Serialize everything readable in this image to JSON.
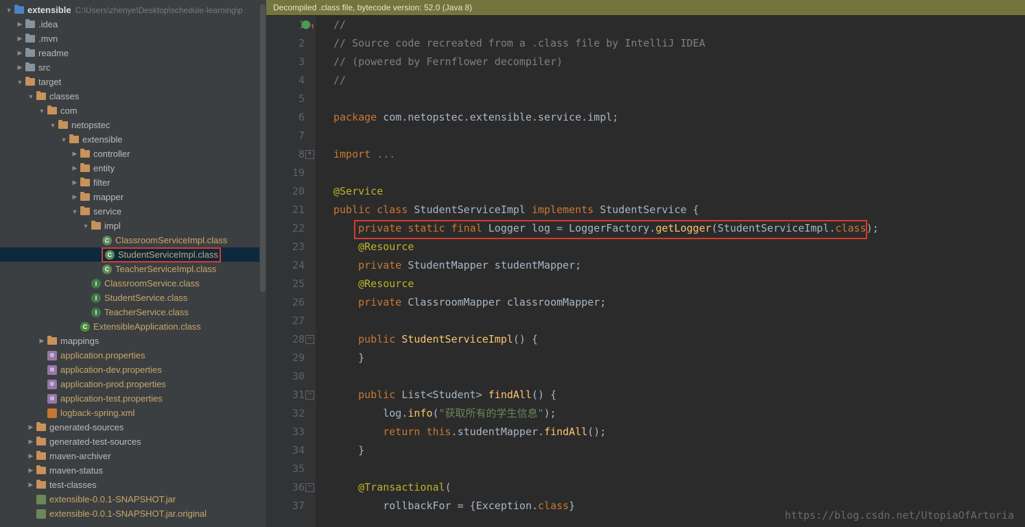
{
  "sidebar": {
    "root": {
      "name": "extensible",
      "path": "C:\\Users\\zhenye\\Desktop\\schedule-learning\\p"
    },
    "items": [
      {
        "indent": 0,
        "arrow": "down",
        "icon": "folder-blue",
        "label": "extensible",
        "bold": true,
        "path": "C:\\Users\\zhenye\\Desktop\\schedule-learning\\p"
      },
      {
        "indent": 1,
        "arrow": "right",
        "icon": "folder",
        "label": ".idea"
      },
      {
        "indent": 1,
        "arrow": "right",
        "icon": "folder",
        "label": ".mvn"
      },
      {
        "indent": 1,
        "arrow": "right",
        "icon": "folder",
        "label": "readme"
      },
      {
        "indent": 1,
        "arrow": "right",
        "icon": "folder",
        "label": "src"
      },
      {
        "indent": 1,
        "arrow": "down",
        "icon": "folder-orange",
        "label": "target"
      },
      {
        "indent": 2,
        "arrow": "down",
        "icon": "folder-orange",
        "label": "classes"
      },
      {
        "indent": 3,
        "arrow": "down",
        "icon": "folder-orange",
        "label": "com"
      },
      {
        "indent": 4,
        "arrow": "down",
        "icon": "folder-orange",
        "label": "netopstec"
      },
      {
        "indent": 5,
        "arrow": "down",
        "icon": "folder-orange",
        "label": "extensible"
      },
      {
        "indent": 6,
        "arrow": "right",
        "icon": "folder-orange",
        "label": "controller"
      },
      {
        "indent": 6,
        "arrow": "right",
        "icon": "folder-orange",
        "label": "entity"
      },
      {
        "indent": 6,
        "arrow": "right",
        "icon": "folder-orange",
        "label": "filter"
      },
      {
        "indent": 6,
        "arrow": "right",
        "icon": "folder-orange",
        "label": "mapper"
      },
      {
        "indent": 6,
        "arrow": "down",
        "icon": "folder-orange",
        "label": "service"
      },
      {
        "indent": 7,
        "arrow": "down",
        "icon": "folder-orange",
        "label": "impl"
      },
      {
        "indent": 8,
        "arrow": "",
        "icon": "class",
        "label": "ClassroomServiceImpl.class",
        "gold": true
      },
      {
        "indent": 8,
        "arrow": "",
        "icon": "class",
        "label": "StudentServiceImpl.class",
        "gold": true,
        "selected": true,
        "redbox": true
      },
      {
        "indent": 8,
        "arrow": "",
        "icon": "class",
        "label": "TeacherServiceImpl.class",
        "gold": true
      },
      {
        "indent": 7,
        "arrow": "",
        "icon": "interface",
        "label": "ClassroomService.class",
        "gold": true
      },
      {
        "indent": 7,
        "arrow": "",
        "icon": "interface",
        "label": "StudentService.class",
        "gold": true
      },
      {
        "indent": 7,
        "arrow": "",
        "icon": "interface",
        "label": "TeacherService.class",
        "gold": true
      },
      {
        "indent": 6,
        "arrow": "",
        "icon": "app",
        "label": "ExtensibleApplication.class",
        "gold": true
      },
      {
        "indent": 3,
        "arrow": "right",
        "icon": "folder-orange",
        "label": "mappings"
      },
      {
        "indent": 3,
        "arrow": "",
        "icon": "prop",
        "label": "application.properties",
        "gold": true
      },
      {
        "indent": 3,
        "arrow": "",
        "icon": "prop",
        "label": "application-dev.properties",
        "gold": true
      },
      {
        "indent": 3,
        "arrow": "",
        "icon": "prop",
        "label": "application-prod.properties",
        "gold": true
      },
      {
        "indent": 3,
        "arrow": "",
        "icon": "prop",
        "label": "application-test.properties",
        "gold": true
      },
      {
        "indent": 3,
        "arrow": "",
        "icon": "xml",
        "label": "logback-spring.xml",
        "gold": true
      },
      {
        "indent": 2,
        "arrow": "right",
        "icon": "folder-orange",
        "label": "generated-sources"
      },
      {
        "indent": 2,
        "arrow": "right",
        "icon": "folder-orange",
        "label": "generated-test-sources"
      },
      {
        "indent": 2,
        "arrow": "right",
        "icon": "folder-orange",
        "label": "maven-archiver"
      },
      {
        "indent": 2,
        "arrow": "right",
        "icon": "folder-orange",
        "label": "maven-status"
      },
      {
        "indent": 2,
        "arrow": "right",
        "icon": "folder-orange",
        "label": "test-classes"
      },
      {
        "indent": 2,
        "arrow": "",
        "icon": "jar",
        "label": "extensible-0.0.1-SNAPSHOT.jar",
        "gold": true
      },
      {
        "indent": 2,
        "arrow": "",
        "icon": "jar",
        "label": "extensible-0.0.1-SNAPSHOT.jar.original",
        "gold": true
      }
    ]
  },
  "editor": {
    "banner": "Decompiled .class file, bytecode version: 52.0 (Java 8)",
    "watermark": "https://blog.csdn.net/UtopiaOfArtoria",
    "lines": [
      {
        "n": 1,
        "tokens": [
          [
            "cm",
            "//"
          ]
        ]
      },
      {
        "n": 2,
        "tokens": [
          [
            "cm",
            "// Source code recreated from a .class file by IntelliJ IDEA"
          ]
        ]
      },
      {
        "n": 3,
        "tokens": [
          [
            "cm",
            "// (powered by Fernflower decompiler)"
          ]
        ]
      },
      {
        "n": 4,
        "tokens": [
          [
            "cm",
            "//"
          ]
        ]
      },
      {
        "n": 5,
        "tokens": []
      },
      {
        "n": 6,
        "tokens": [
          [
            "kw",
            "package "
          ],
          [
            "cls",
            "com.netopstec.extensible.service.impl"
          ],
          [
            "cls",
            ";"
          ]
        ]
      },
      {
        "n": 7,
        "tokens": []
      },
      {
        "n": 8,
        "fold": "+",
        "tokens": [
          [
            "kw",
            "import "
          ],
          [
            "cm",
            "..."
          ]
        ]
      },
      {
        "n": 19,
        "tokens": []
      },
      {
        "n": 20,
        "indent": 0,
        "tokens": [
          [
            "ann",
            "@Service"
          ]
        ]
      },
      {
        "n": 21,
        "tokens": [
          [
            "kw",
            "public class "
          ],
          [
            "cls",
            "StudentServiceImpl "
          ],
          [
            "kw",
            "implements "
          ],
          [
            "cls",
            "StudentService {"
          ]
        ]
      },
      {
        "n": 22,
        "redbox": true,
        "tokens": [
          [
            "",
            "    "
          ],
          [
            "kw",
            "private static final "
          ],
          [
            "cls",
            "Logger log = LoggerFactory."
          ],
          [
            "fn",
            "getLogger"
          ],
          [
            "cls",
            "(StudentServiceImpl."
          ],
          [
            "kw",
            "class"
          ],
          [
            "cls",
            ");"
          ]
        ]
      },
      {
        "n": 23,
        "tokens": [
          [
            "",
            "    "
          ],
          [
            "ann",
            "@Resource"
          ]
        ]
      },
      {
        "n": 24,
        "tokens": [
          [
            "",
            "    "
          ],
          [
            "kw",
            "private "
          ],
          [
            "cls",
            "StudentMapper studentMapper;"
          ]
        ]
      },
      {
        "n": 25,
        "tokens": [
          [
            "",
            "    "
          ],
          [
            "ann",
            "@Resource"
          ]
        ]
      },
      {
        "n": 26,
        "tokens": [
          [
            "",
            "    "
          ],
          [
            "kw",
            "private "
          ],
          [
            "cls",
            "ClassroomMapper classroomMapper;"
          ]
        ]
      },
      {
        "n": 27,
        "tokens": []
      },
      {
        "n": 28,
        "fold": "-",
        "tokens": [
          [
            "",
            "    "
          ],
          [
            "kw",
            "public "
          ],
          [
            "fn",
            "StudentServiceImpl"
          ],
          [
            "cls",
            "() {"
          ]
        ]
      },
      {
        "n": 29,
        "tokens": [
          [
            "",
            "    }"
          ]
        ]
      },
      {
        "n": 30,
        "tokens": []
      },
      {
        "n": 31,
        "marker": "impl",
        "fold": "-",
        "tokens": [
          [
            "",
            "    "
          ],
          [
            "kw",
            "public "
          ],
          [
            "cls",
            "List<Student> "
          ],
          [
            "fn",
            "findAll"
          ],
          [
            "cls",
            "() {"
          ]
        ]
      },
      {
        "n": 32,
        "tokens": [
          [
            "",
            "        log."
          ],
          [
            "fn",
            "info"
          ],
          [
            "cls",
            "("
          ],
          [
            "str",
            "\"获取所有的学生信息\""
          ],
          [
            "cls",
            ");"
          ]
        ]
      },
      {
        "n": 33,
        "tokens": [
          [
            "",
            "        "
          ],
          [
            "kw",
            "return this"
          ],
          [
            "cls",
            ".studentMapper."
          ],
          [
            "fn",
            "findAll"
          ],
          [
            "cls",
            "();"
          ]
        ]
      },
      {
        "n": 34,
        "tokens": [
          [
            "",
            "    }"
          ]
        ]
      },
      {
        "n": 35,
        "tokens": []
      },
      {
        "n": 36,
        "fold": "-",
        "tokens": [
          [
            "",
            "    "
          ],
          [
            "ann",
            "@Transactional"
          ],
          [
            "cls",
            "("
          ]
        ]
      },
      {
        "n": 37,
        "tokens": [
          [
            "",
            "        rollbackFor = {Exception."
          ],
          [
            "kw",
            "class"
          ],
          [
            "cls",
            "}"
          ]
        ]
      }
    ]
  }
}
